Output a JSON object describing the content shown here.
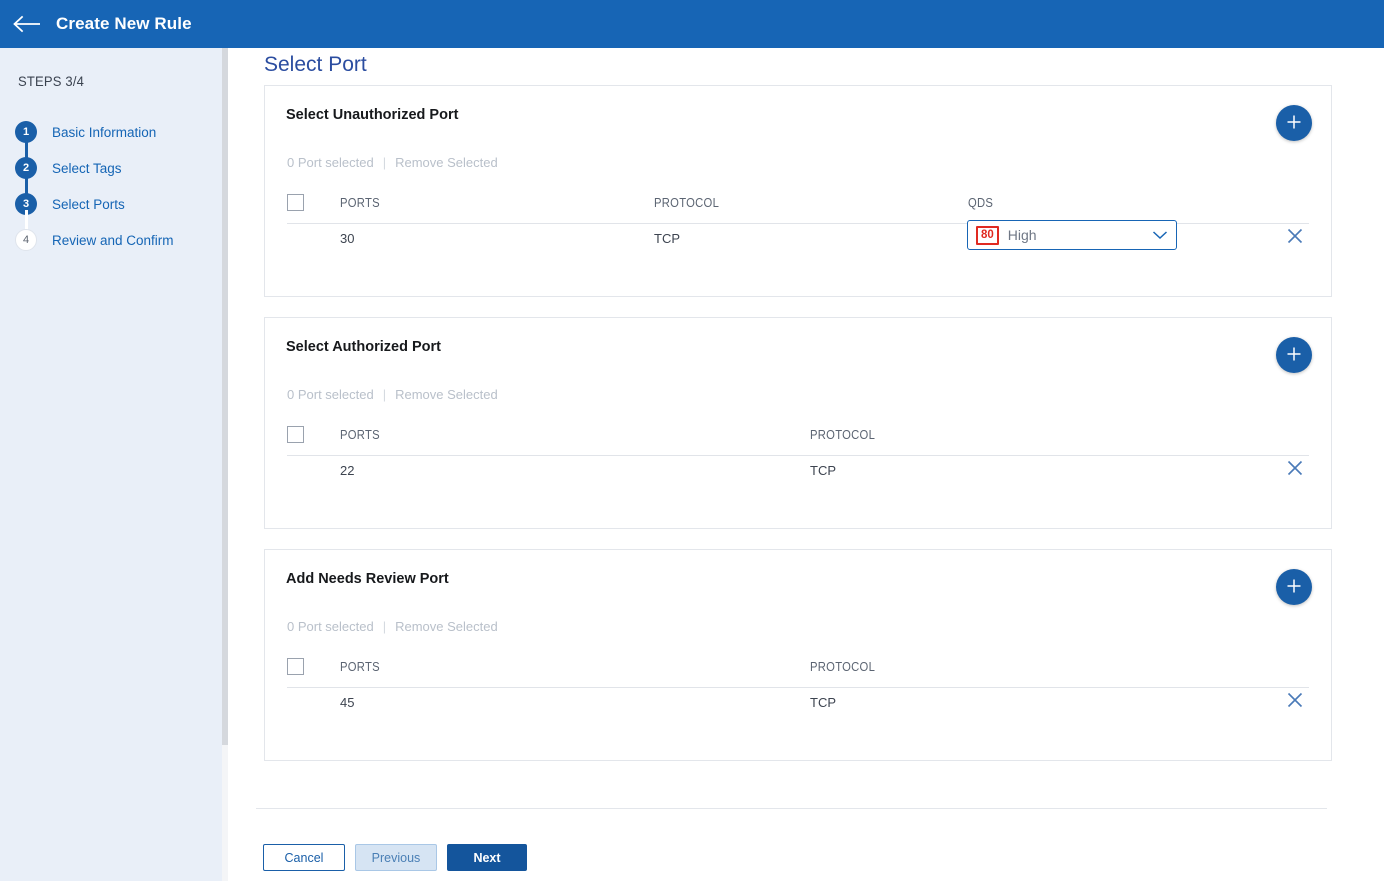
{
  "header": {
    "title": "Create New Rule",
    "back_icon": "arrow-left-icon"
  },
  "sidebar": {
    "steps_label": "STEPS 3/4",
    "steps": [
      {
        "number": "1",
        "label": "Basic Information",
        "state": "done"
      },
      {
        "number": "2",
        "label": "Select Tags",
        "state": "done"
      },
      {
        "number": "3",
        "label": "Select Ports",
        "state": "done"
      },
      {
        "number": "4",
        "label": "Review and Confirm",
        "state": "todo"
      }
    ]
  },
  "main": {
    "page_title": "Select Port",
    "cards": [
      {
        "title": "Select Unauthorized Port",
        "add_icon": "plus-icon",
        "selection_count": "0 Port selected",
        "separator": "|",
        "remove_selected": "Remove Selected",
        "columns": [
          "PORTS",
          "PROTOCOL",
          "QDS"
        ],
        "row": {
          "port": "30",
          "protocol": "TCP",
          "qds_score": "80",
          "qds_level": "High",
          "remove_icon": "close-icon",
          "chevron_icon": "chevron-down-icon"
        }
      },
      {
        "title": "Select Authorized Port",
        "add_icon": "plus-icon",
        "selection_count": "0 Port selected",
        "separator": "|",
        "remove_selected": "Remove Selected",
        "columns": [
          "PORTS",
          "PROTOCOL"
        ],
        "row": {
          "port": "22",
          "protocol": "TCP",
          "remove_icon": "close-icon"
        }
      },
      {
        "title": "Add Needs Review Port",
        "add_icon": "plus-icon",
        "selection_count": "0 Port selected",
        "separator": "|",
        "remove_selected": "Remove Selected",
        "columns": [
          "PORTS",
          "PROTOCOL"
        ],
        "row": {
          "port": "45",
          "protocol": "TCP",
          "remove_icon": "close-icon"
        }
      }
    ],
    "footer": {
      "cancel": "Cancel",
      "previous": "Previous",
      "next": "Next"
    }
  },
  "colors": {
    "header_blue": "#1765b5",
    "sidebar_blue": "#e9eff8",
    "accent_blue": "#1a5fa8",
    "title_blue": "#2b4da0",
    "badge_red": "#e02a21",
    "muted_gray": "#b9c0ca"
  }
}
